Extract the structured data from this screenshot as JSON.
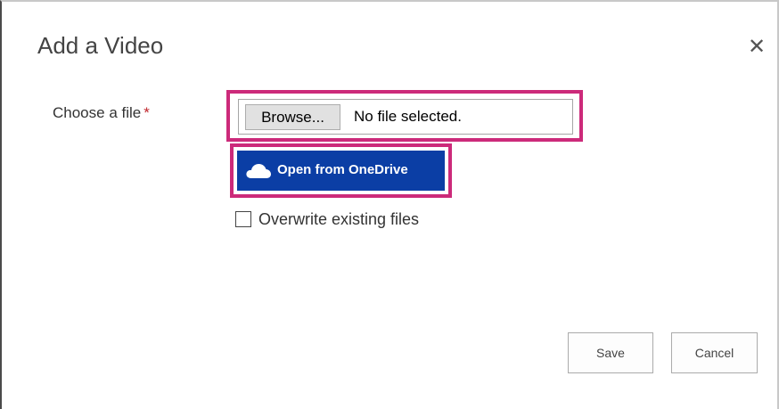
{
  "dialog": {
    "title": "Add a Video",
    "close_glyph": "✕",
    "close_icon": "close-icon"
  },
  "form": {
    "choose_file_label": "Choose a file",
    "required_marker": "*",
    "browse_label": "Browse...",
    "file_status": "No file selected.",
    "onedrive_label": "Open from OneDrive",
    "onedrive_icon": "cloud-icon",
    "overwrite_label": "Overwrite existing files",
    "overwrite_checked": false
  },
  "actions": {
    "save_label": "Save",
    "cancel_label": "Cancel"
  },
  "colors": {
    "highlight": "#cc2a7a",
    "onedrive_button": "#0b3ea5",
    "required": "#c0272d"
  }
}
